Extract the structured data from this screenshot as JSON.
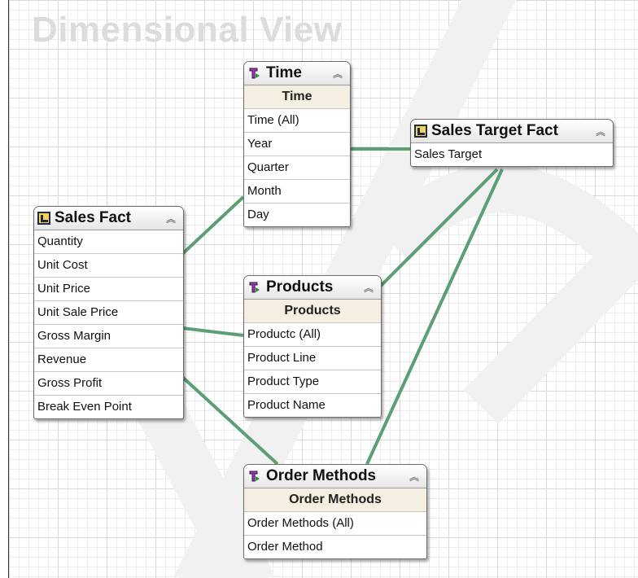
{
  "canvas": {
    "title": "Dimensional View"
  },
  "colors": {
    "link": "#5c9e76",
    "subheader": "#f5efe2",
    "fact_icon": "#f3d35a",
    "dim_icon": "#9b3bb0"
  },
  "tables": {
    "time": {
      "title": "Time",
      "icon": "dimension-icon",
      "subheader": "Time",
      "rows": [
        "Time (All)",
        "Year",
        "Quarter",
        "Month",
        "Day"
      ]
    },
    "sales_target_fact": {
      "title": "Sales Target Fact",
      "icon": "fact-icon",
      "rows": [
        "Sales Target"
      ]
    },
    "sales_fact": {
      "title": "Sales Fact",
      "icon": "fact-icon",
      "rows": [
        "Quantity",
        "Unit Cost",
        "Unit Price",
        "Unit Sale Price",
        "Gross Margin",
        "Revenue",
        "Gross Profit",
        "Break Even Point"
      ]
    },
    "products": {
      "title": "Products",
      "icon": "dimension-icon",
      "subheader": "Products",
      "rows": [
        "Productc (All)",
        "Product Line",
        "Product Type",
        "Product Name"
      ]
    },
    "order_methods": {
      "title": "Order Methods",
      "icon": "dimension-icon",
      "subheader": "Order Methods",
      "rows": [
        "Order Methods (All)",
        "Order Method"
      ]
    }
  },
  "relationships": [
    {
      "from": "Sales Fact",
      "to": "Time"
    },
    {
      "from": "Sales Fact",
      "to": "Products"
    },
    {
      "from": "Sales Fact",
      "to": "Order Methods"
    },
    {
      "from": "Sales Target Fact",
      "to": "Time"
    },
    {
      "from": "Sales Target Fact",
      "to": "Products"
    },
    {
      "from": "Sales Target Fact",
      "to": "Order Methods"
    }
  ]
}
